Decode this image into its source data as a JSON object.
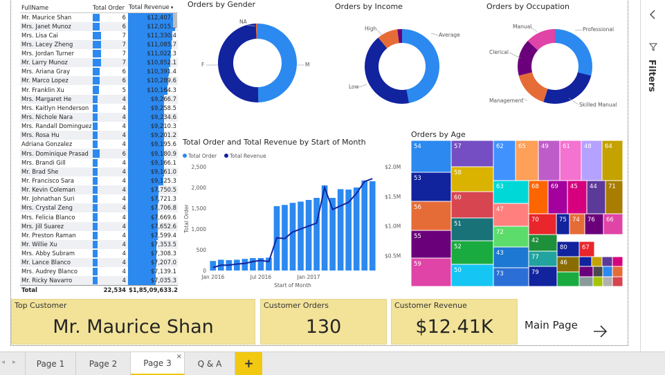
{
  "table": {
    "headers": [
      "FullName",
      "Total Order",
      "Total Revenue"
    ],
    "rows": [
      [
        "Mr. Maurice Shan",
        "6",
        "$12,407.9"
      ],
      [
        "Mrs. Janet Munoz",
        "6",
        "$12,015.3"
      ],
      [
        "Mrs. Lisa Cai",
        "7",
        "$11,330.4"
      ],
      [
        "Mrs. Lacey Zheng",
        "7",
        "$11,085.7"
      ],
      [
        "Mrs. Jordan Turner",
        "7",
        "$11,022.3"
      ],
      [
        "Mr. Larry Munoz",
        "7",
        "$10,852.1"
      ],
      [
        "Mrs. Ariana Gray",
        "6",
        "$10,391.4"
      ],
      [
        "Mr. Marco Lopez",
        "6",
        "$10,289.6"
      ],
      [
        "Mr. Franklin Xu",
        "5",
        "$10,164.3"
      ],
      [
        "Mrs. Margaret He",
        "4",
        "$9,266.7"
      ],
      [
        "Mrs. Kaitlyn Henderson",
        "4",
        "$9,258.5"
      ],
      [
        "Mrs. Nichole Nara",
        "4",
        "$9,234.6"
      ],
      [
        "Mrs. Randall Dominguez",
        "4",
        "$9,210.3"
      ],
      [
        "Mrs. Rosa Hu",
        "4",
        "$9,201.2"
      ],
      [
        "Adriana Gonzalez",
        "4",
        "$9,195.6"
      ],
      [
        "Mrs. Dominique Prasad",
        "6",
        "$9,180.9"
      ],
      [
        "Mrs. Brandi Gill",
        "4",
        "$9,166.1"
      ],
      [
        "Mr. Brad She",
        "4",
        "$9,161.0"
      ],
      [
        "Mr. Francisco Sara",
        "4",
        "$9,125.3"
      ],
      [
        "Mr. Kevin Coleman",
        "4",
        "$7,750.5"
      ],
      [
        "Mr. Johnathan Suri",
        "4",
        "$7,721.3"
      ],
      [
        "Mrs. Crystal Zeng",
        "4",
        "$7,706.8"
      ],
      [
        "Mrs. Felicia Blanco",
        "4",
        "$7,669.6"
      ],
      [
        "Mrs. Jill Suarez",
        "4",
        "$7,652.6"
      ],
      [
        "Mr. Preston Raman",
        "4",
        "$7,599.4"
      ],
      [
        "Mr. Willie Xu",
        "4",
        "$7,353.5"
      ],
      [
        "Mrs. Abby Subram",
        "4",
        "$7,308.3"
      ],
      [
        "Mr. Lance Blanco",
        "4",
        "$7,207.0"
      ],
      [
        "Mrs. Audrey Blanco",
        "4",
        "$7,139.1"
      ],
      [
        "Mr. Ricky Navarro",
        "4",
        "$7,035.3"
      ]
    ],
    "orders_num": [
      6,
      6,
      7,
      7,
      7,
      7,
      6,
      6,
      5,
      4,
      4,
      4,
      4,
      4,
      4,
      6,
      4,
      4,
      4,
      4,
      4,
      4,
      4,
      4,
      4,
      4,
      4,
      4,
      4,
      4
    ],
    "revenue_num": [
      12407.9,
      12015.3,
      11330.4,
      11085.7,
      11022.3,
      10852.1,
      10391.4,
      10289.6,
      10164.3,
      9266.7,
      9258.5,
      9234.6,
      9210.3,
      9201.2,
      9195.6,
      9180.9,
      9166.1,
      9161.0,
      9125.3,
      7750.5,
      7721.3,
      7706.8,
      7669.6,
      7652.6,
      7599.4,
      7353.5,
      7308.3,
      7207.0,
      7139.1,
      7035.3
    ],
    "total_label": "Total",
    "total_orders": "22,534",
    "total_revenue": "$1,85,09,633.2"
  },
  "chart_data": [
    {
      "type": "pie",
      "title": "Orders by Gender",
      "categories": [
        "M",
        "F",
        "NA"
      ],
      "values": [
        49.6,
        49.8,
        0.6
      ],
      "colors": [
        "#2b89f0",
        "#12239e",
        "#e66c37"
      ]
    },
    {
      "type": "pie",
      "title": "Orders by Income",
      "categories": [
        "Average",
        "Low",
        "High"
      ],
      "values": [
        47,
        42,
        9,
        2
      ],
      "labels": [
        "Average",
        "Low",
        "High",
        ""
      ],
      "colors": [
        "#2b89f0",
        "#12239e",
        "#e66c37",
        "#6b007b"
      ]
    },
    {
      "type": "pie",
      "title": "Orders by Occupation",
      "categories": [
        "Professional",
        "Skilled Manual",
        "Management",
        "Clerical",
        "Manual"
      ],
      "values": [
        29,
        26,
        16,
        16,
        13
      ],
      "colors": [
        "#2b89f0",
        "#12239e",
        "#e66c37",
        "#6b007b",
        "#e044a7"
      ]
    },
    {
      "type": "bar",
      "title": "Total Order and Total Revenue by Start of Month",
      "xlabel": "Start of Month",
      "ylabel": "Total Order",
      "legend": [
        "Total  Order",
        "Total Revenue"
      ],
      "x_ticks": [
        "Jan 2016",
        "Jul 2016",
        "Jan 2017"
      ],
      "y_ticks": [
        "0",
        "500",
        "1,000",
        "1,500",
        "2,000",
        "2,500"
      ],
      "y2_ticks": [
        "$0.5M",
        "$1.0M",
        "$1.5M",
        "$2.0M"
      ],
      "ylim": [
        0,
        2500
      ],
      "y2lim": [
        0.25,
        2.0
      ],
      "values": [
        230,
        260,
        250,
        260,
        280,
        300,
        300,
        310,
        1550,
        1580,
        1630,
        1660,
        1700,
        1750,
        2050,
        1750,
        1960,
        1950,
        2000,
        2170,
        2150
      ],
      "revenue": [
        0.3,
        0.34,
        0.34,
        0.36,
        0.37,
        0.4,
        0.42,
        0.4,
        0.8,
        0.79,
        0.9,
        0.95,
        1.0,
        1.05,
        1.65,
        1.28,
        1.34,
        1.4,
        1.55,
        1.75,
        1.8
      ]
    },
    {
      "type": "heatmap",
      "title": "Orders by Age",
      "cells": [
        "54",
        "53",
        "56",
        "55",
        "59",
        "57",
        "58",
        "60",
        "51",
        "52",
        "50",
        "62",
        "65",
        "49",
        "61",
        "48",
        "64",
        "63",
        "68",
        "69",
        "45",
        "44",
        "71",
        "47",
        "70",
        "75",
        "74",
        "76",
        "66",
        "72",
        "42",
        "80",
        "67",
        "43",
        "77",
        "46",
        "73",
        "79"
      ]
    }
  ],
  "cards": {
    "top_customer_title": "Top Customer",
    "top_customer_value": "Mr. Maurice Shan",
    "orders_title": "Customer Orders",
    "orders_value": "130",
    "revenue_title": "Customer Revenue",
    "revenue_value": "$12.41K"
  },
  "nav": {
    "main_page": "Main Page"
  },
  "tabs": [
    "Page 1",
    "Page 2",
    "Page 3",
    "Q & A"
  ],
  "active_tab": "Page 3",
  "right_pane": {
    "filters_label": "Filters"
  }
}
